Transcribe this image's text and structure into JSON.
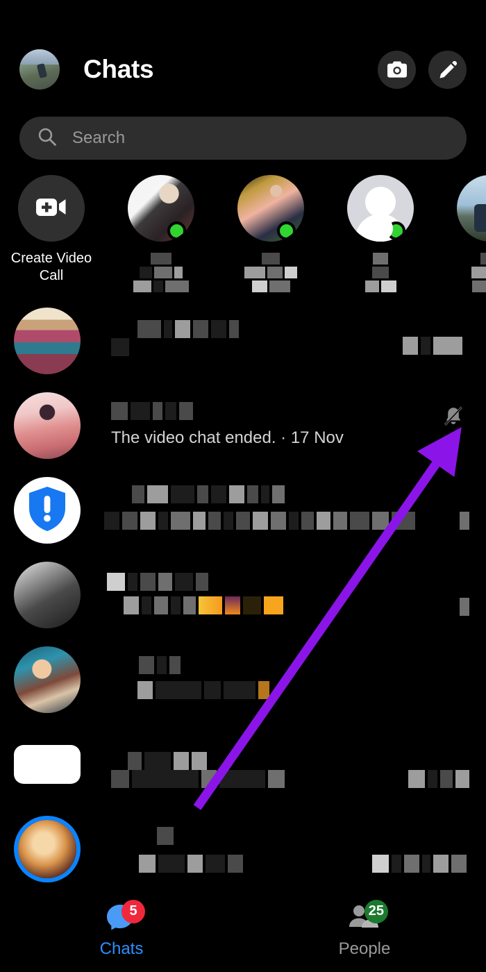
{
  "header": {
    "title": "Chats",
    "avatar_name": "user-profile-photo",
    "camera_icon": "camera-icon",
    "compose_icon": "pencil-compose-icon"
  },
  "search": {
    "placeholder": "Search",
    "icon": "search-icon",
    "value": ""
  },
  "stories": {
    "create_call": {
      "label": "Create Video\nCall",
      "icon": "video-camera-plus-icon"
    },
    "items": [
      {
        "name_redacted": true,
        "active": true,
        "photo": "ph-a"
      },
      {
        "name_redacted": true,
        "active": true,
        "photo": "ph-b"
      },
      {
        "name_redacted": true,
        "active": true,
        "photo": "ph-c"
      },
      {
        "name_redacted": true,
        "active": true,
        "photo": "ph-d"
      },
      {
        "name_redacted": true,
        "active": false,
        "photo": "ph-e",
        "partial_label": "P\nS"
      }
    ]
  },
  "chat_list": [
    {
      "avatar": "av-group",
      "name_redacted": true,
      "preview_redacted": true,
      "muted": false
    },
    {
      "avatar": "av-pink",
      "name_redacted": true,
      "preview": "The video chat ended. · 17 Nov",
      "muted": true,
      "mute_icon": "bell-muted-icon"
    },
    {
      "avatar": "av-shield",
      "name_redacted": true,
      "preview_redacted": true,
      "muted": false,
      "icon": "shield-exclamation-icon"
    },
    {
      "avatar": "av-bw",
      "name_redacted": true,
      "preview_redacted": true,
      "muted": false
    },
    {
      "avatar": "av-stage",
      "name_redacted": true,
      "preview_redacted": true,
      "muted": false
    },
    {
      "avatar": "av-white",
      "name_redacted": true,
      "preview_redacted": true,
      "muted": false
    },
    {
      "avatar": "av-moon",
      "name_redacted": true,
      "preview_redacted": true,
      "muted": false,
      "story_ring": true
    }
  ],
  "bottom_nav": {
    "tabs": [
      {
        "label": "Chats",
        "badge": "5",
        "active": true,
        "icon": "chat-bubble-icon",
        "badge_color": "#f0283c"
      },
      {
        "label": "People",
        "badge": "25",
        "active": false,
        "icon": "people-icon",
        "badge_color": "#1b7a2e"
      }
    ]
  },
  "annotation": {
    "arrow_color": "#8b15e8",
    "points_to": "bell-muted-icon"
  },
  "colors": {
    "background": "#000000",
    "surface": "#2e2e2e",
    "accent_blue": "#2e8fff",
    "active_green": "#31d431",
    "arrow_purple": "#8b15e8"
  }
}
